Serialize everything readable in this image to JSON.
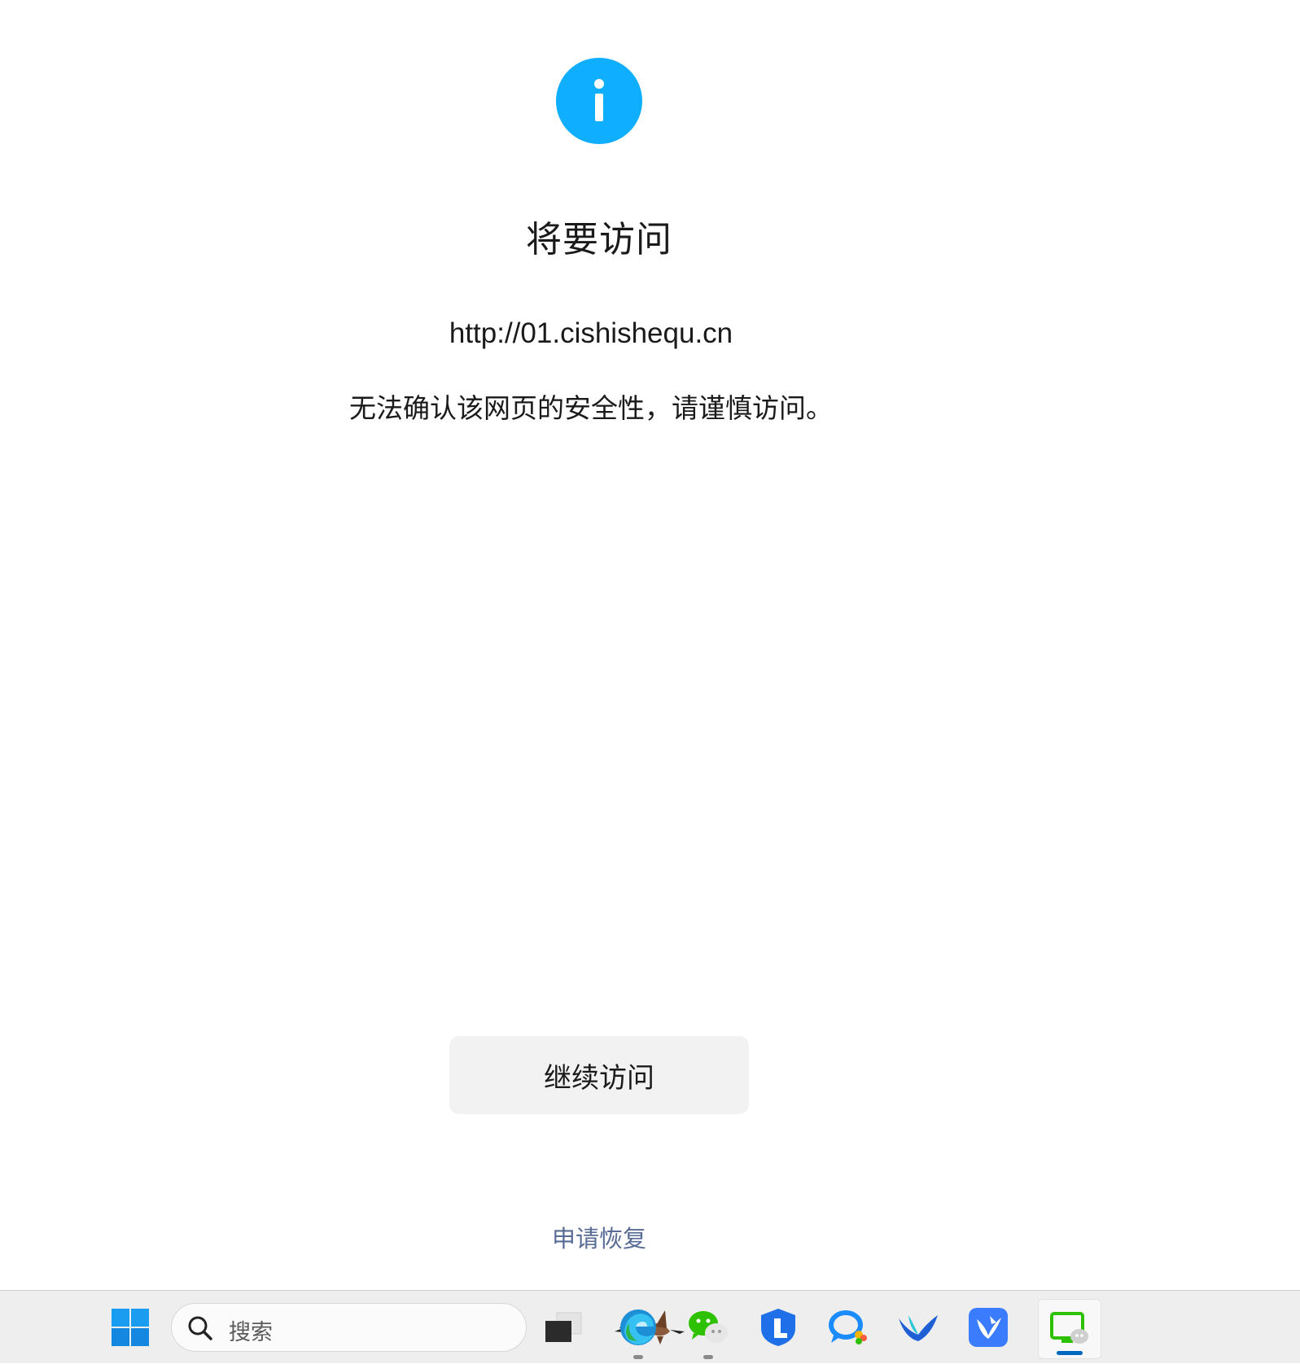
{
  "main": {
    "title": "将要访问",
    "url": "http://01.cishishequ.cn",
    "warning": "无法确认该网页的安全性，请谨慎访问。",
    "continue_label": "继续访问",
    "appeal_label": "申请恢复",
    "info_icon": "info-icon",
    "accent_color": "#10aeff",
    "link_color": "#576b95"
  },
  "taskbar": {
    "search_placeholder": "搜索",
    "apps": [
      {
        "name": "start-icon"
      },
      {
        "name": "task-view-icon"
      },
      {
        "name": "edge-icon"
      },
      {
        "name": "wechat-icon"
      },
      {
        "name": "security-shield-icon"
      },
      {
        "name": "chat-app-icon"
      },
      {
        "name": "bird-app-icon"
      },
      {
        "name": "feishu-icon"
      },
      {
        "name": "wechat-window-icon"
      }
    ]
  }
}
